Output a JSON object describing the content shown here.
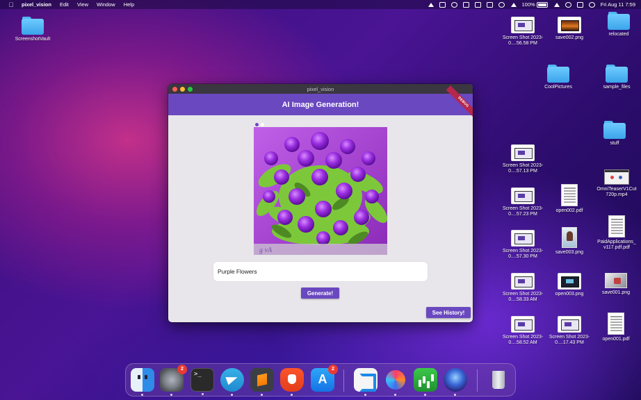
{
  "menubar": {
    "app_name": "pixel_vision",
    "menus": [
      "Edit",
      "View",
      "Window",
      "Help"
    ],
    "battery": "100%",
    "datetime": "Fri Aug 11  7:59"
  },
  "desktop": {
    "items": [
      {
        "label": "ScreenshotVault",
        "kind": "folder"
      },
      {
        "label": "Screen Shot 2023-0....56.58 PM",
        "kind": "screenshot"
      },
      {
        "label": "save002.png",
        "kind": "image"
      },
      {
        "label": "relocated",
        "kind": "folder"
      },
      {
        "label": "CoolPictures",
        "kind": "folder"
      },
      {
        "label": "sample_files",
        "kind": "folder"
      },
      {
        "label": "stuff",
        "kind": "folder"
      },
      {
        "label": "Screen Shot 2023-0....57.13 PM",
        "kind": "screenshot"
      },
      {
        "label": "OmniTeaserV1Cut 720p.mp4",
        "kind": "video"
      },
      {
        "label": "Screen Shot 2023-0....57.23 PM",
        "kind": "screenshot"
      },
      {
        "label": "open002.pdf",
        "kind": "pdf"
      },
      {
        "label": "PaidApplications_ v117.pdf.pdf",
        "kind": "pdf"
      },
      {
        "label": "Screen Shot 2023-0....57.30 PM",
        "kind": "screenshot"
      },
      {
        "label": "save003.png",
        "kind": "image"
      },
      {
        "label": "Screen Shot 2023-0....58.33 AM",
        "kind": "screenshot"
      },
      {
        "label": "open003.png",
        "kind": "image"
      },
      {
        "label": "save001.png",
        "kind": "image"
      },
      {
        "label": "Screen Shot 2023-0....58.52 AM",
        "kind": "screenshot"
      },
      {
        "label": "Screen Shot 2023-0....17.43 PM",
        "kind": "screenshot"
      },
      {
        "label": "open001.pdf",
        "kind": "pdf"
      }
    ]
  },
  "window": {
    "title": "pixel_vision",
    "app_bar_title": "AI Image Generation!",
    "debug_banner": "DEBUG",
    "carousel": {
      "current_page": 1,
      "total_pages": 2
    },
    "prompt_value": "Purple Flowers",
    "generate_label": "Generate!",
    "history_label": "See History!"
  },
  "dock": {
    "apps": [
      {
        "name": "finder-icon",
        "badge": ""
      },
      {
        "name": "system-settings-icon",
        "badge": "2"
      },
      {
        "name": "terminal-icon",
        "badge": ""
      },
      {
        "name": "telegram-icon",
        "badge": ""
      },
      {
        "name": "sublime-text-icon",
        "badge": ""
      },
      {
        "name": "brave-browser-icon",
        "badge": ""
      },
      {
        "name": "app-store-icon",
        "badge": "2"
      },
      {
        "name": "vscode-icon",
        "badge": ""
      },
      {
        "name": "arc-browser-icon",
        "badge": ""
      },
      {
        "name": "numbers-icon",
        "badge": ""
      },
      {
        "name": "pixel-vision-app-icon",
        "badge": ""
      },
      {
        "name": "trash-icon",
        "badge": ""
      }
    ]
  },
  "colors": {
    "accent": "#6a48c0",
    "badge": "#ea3b32",
    "debug_banner": "#b6274d"
  }
}
